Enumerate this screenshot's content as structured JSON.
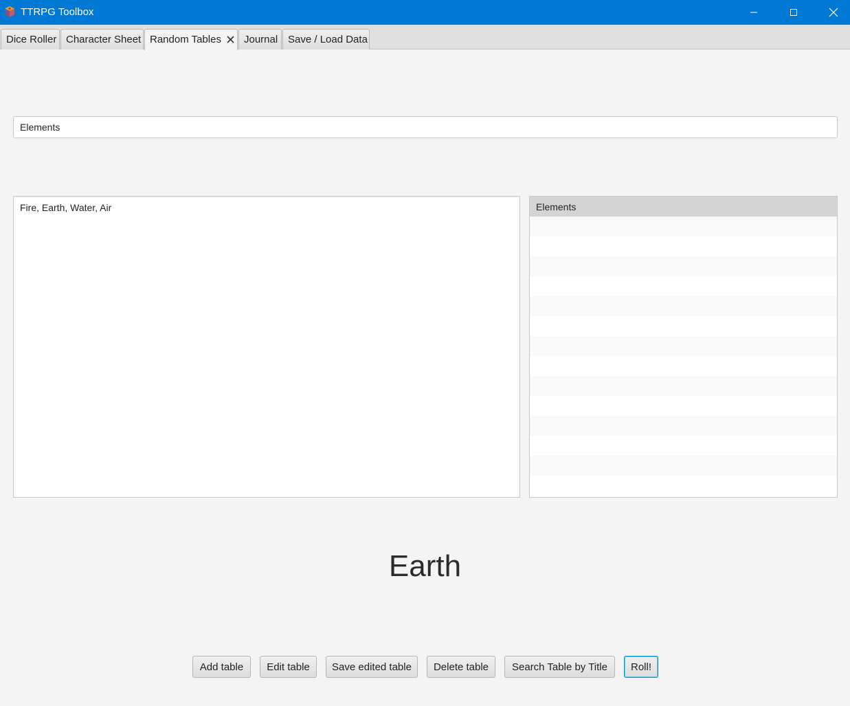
{
  "window": {
    "title": "TTRPG Toolbox"
  },
  "tabs": [
    {
      "label": "Dice Roller"
    },
    {
      "label": "Character Sheet"
    },
    {
      "label": "Random Tables",
      "active": true,
      "closable": true
    },
    {
      "label": "Journal"
    },
    {
      "label": "Save / Load Data"
    }
  ],
  "table_title_input": {
    "value": "Elements"
  },
  "entries_area": {
    "value": "Fire, Earth, Water, Air"
  },
  "table_list": {
    "header": "Elements"
  },
  "result": {
    "value": "Earth"
  },
  "buttons": {
    "add": "Add table",
    "edit": "Edit table",
    "save_edited": "Save edited table",
    "delete": "Delete table",
    "search": "Search Table by Title",
    "roll": "Roll!"
  },
  "colors": {
    "titlebar": "#0078d4",
    "background": "#f4f4f4",
    "focus_ring": "#0096c9"
  },
  "icons": {
    "app": "app-icon",
    "minimize": "minimize-icon",
    "maximize": "maximize-icon",
    "close": "close-icon",
    "tab_close": "tab-close-icon"
  }
}
